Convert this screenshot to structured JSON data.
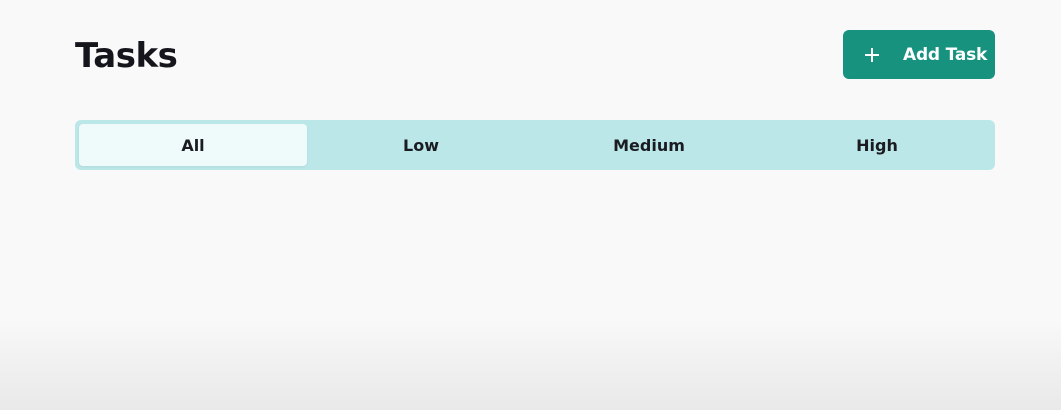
{
  "header": {
    "title": "Tasks",
    "add_button": {
      "icon": "plus-icon",
      "label": "Add Task"
    }
  },
  "filter": {
    "selected": "All",
    "tabs": [
      {
        "label": "All"
      },
      {
        "label": "Low"
      },
      {
        "label": "Medium"
      },
      {
        "label": "High"
      }
    ]
  },
  "colors": {
    "accent": "#17927f",
    "tab_track": "#bbe7e8",
    "tab_active": "#effafa",
    "background": "#f9f9f9"
  }
}
